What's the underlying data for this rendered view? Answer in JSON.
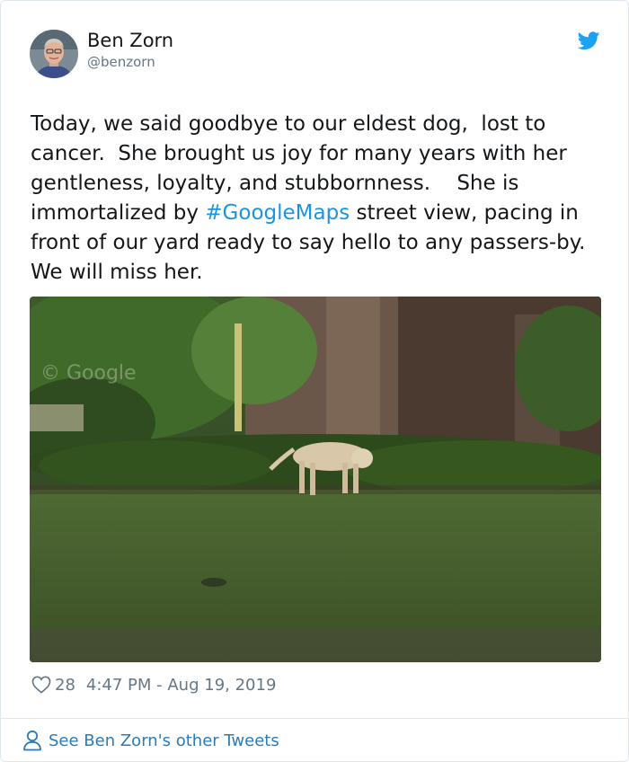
{
  "user": {
    "name": "Ben Zorn",
    "handle": "@benzorn",
    "avatar": "profile-photo"
  },
  "tweet": {
    "text_before": "Today, we said goodbye to our eldest dog,  lost to cancer.  She brought us joy for many years with her gentleness, loyalty, and stubbornness.    She is immortalized by ",
    "hashtag": "#GoogleMaps",
    "text_after": " street view, pacing in front of our yard ready to say hello to any passers-by.  We will miss her.",
    "image_watermark": "© Google"
  },
  "stats": {
    "likes": "28",
    "timestamp": "4:47 PM - Aug 19, 2019"
  },
  "footer": {
    "see_more_label": "See Ben Zorn's other Tweets"
  },
  "icons": {
    "bird": "twitter-bird-icon",
    "heart": "heart-icon",
    "person": "person-icon"
  },
  "colors": {
    "link": "#1b95e0",
    "footer_link": "#2b7bb9",
    "muted": "#657786",
    "text": "#14171a",
    "border": "#e1e8ed"
  }
}
